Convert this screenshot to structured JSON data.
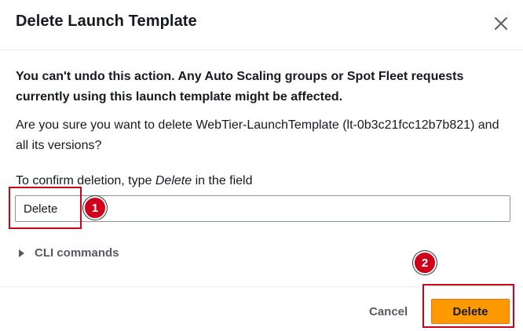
{
  "dialog": {
    "title": "Delete Launch Template",
    "warning": "You can't undo this action. Any Auto Scaling groups or Spot Fleet requests currently using this launch template might be affected.",
    "question": "Are you sure you want to delete WebTier-LaunchTemplate (lt-0b3c21fcc12b7b821) and all its versions?",
    "confirm_label_prefix": "To confirm deletion, type ",
    "confirm_label_keyword": "Delete",
    "confirm_label_suffix": " in the field",
    "input_value": "Delete",
    "cli_label": "CLI commands",
    "cancel_label": "Cancel",
    "delete_label": "Delete"
  },
  "annotations": {
    "step1": "1",
    "step2": "2",
    "highlight_color": "#d0021b"
  },
  "colors": {
    "primary_button": "#ff9900",
    "text": "#16191f",
    "secondary_text": "#545b64"
  },
  "icons": {
    "close": "close-icon",
    "expand": "caret-right-icon"
  }
}
